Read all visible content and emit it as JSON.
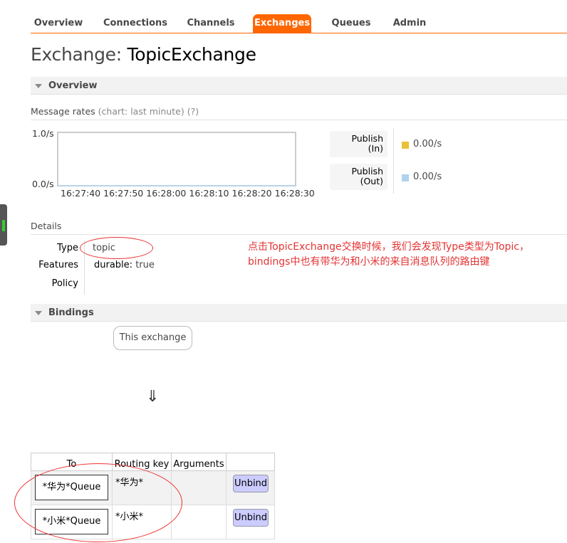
{
  "nav": {
    "items": [
      {
        "label": "Overview"
      },
      {
        "label": "Connections"
      },
      {
        "label": "Channels"
      },
      {
        "label": "Exchanges"
      },
      {
        "label": "Queues"
      },
      {
        "label": "Admin"
      }
    ],
    "active": "Exchanges"
  },
  "page": {
    "title_prefix": "Exchange: ",
    "title_name": "TopicExchange"
  },
  "overview": {
    "section_label": "Overview",
    "message_rates_label": "Message rates",
    "message_rates_chart_hint": "(chart: last minute)",
    "help": "(?)",
    "chart": {
      "y_top": "1.0/s",
      "y_bottom": "0.0/s",
      "x_labels": [
        "16:27:40",
        "16:27:50",
        "16:28:00",
        "16:28:10",
        "16:28:20",
        "16:28:30"
      ]
    },
    "legend": [
      {
        "label_line1": "Publish",
        "label_line2": "(In)",
        "value": "0.00/s",
        "color": "#e9c136"
      },
      {
        "label_line1": "Publish",
        "label_line2": "(Out)",
        "value": "0.00/s",
        "color": "#aed4f0"
      }
    ]
  },
  "details": {
    "label": "Details",
    "type_key": "Type",
    "type_value": "topic",
    "features_key": "Features",
    "features_name": "durable:",
    "features_value": "true",
    "policy_key": "Policy"
  },
  "annotation": {
    "text": "点击TopicExchange交换时候，我们会发现Type类型为Topic，bindings中也有带华为和小米的来自消息队列的路由键",
    "color": "#e33333"
  },
  "bindings": {
    "section_label": "Bindings",
    "this_exchange": "This exchange",
    "arrow": "⇓",
    "headers": {
      "to": "To",
      "routing_key": "Routing key",
      "arguments": "Arguments"
    },
    "rows": [
      {
        "to": "*华为*Queue",
        "routing_key": "*华为*",
        "action": "Unbind"
      },
      {
        "to": "*小米*Queue",
        "routing_key": "*小米*",
        "action": "Unbind"
      }
    ]
  }
}
